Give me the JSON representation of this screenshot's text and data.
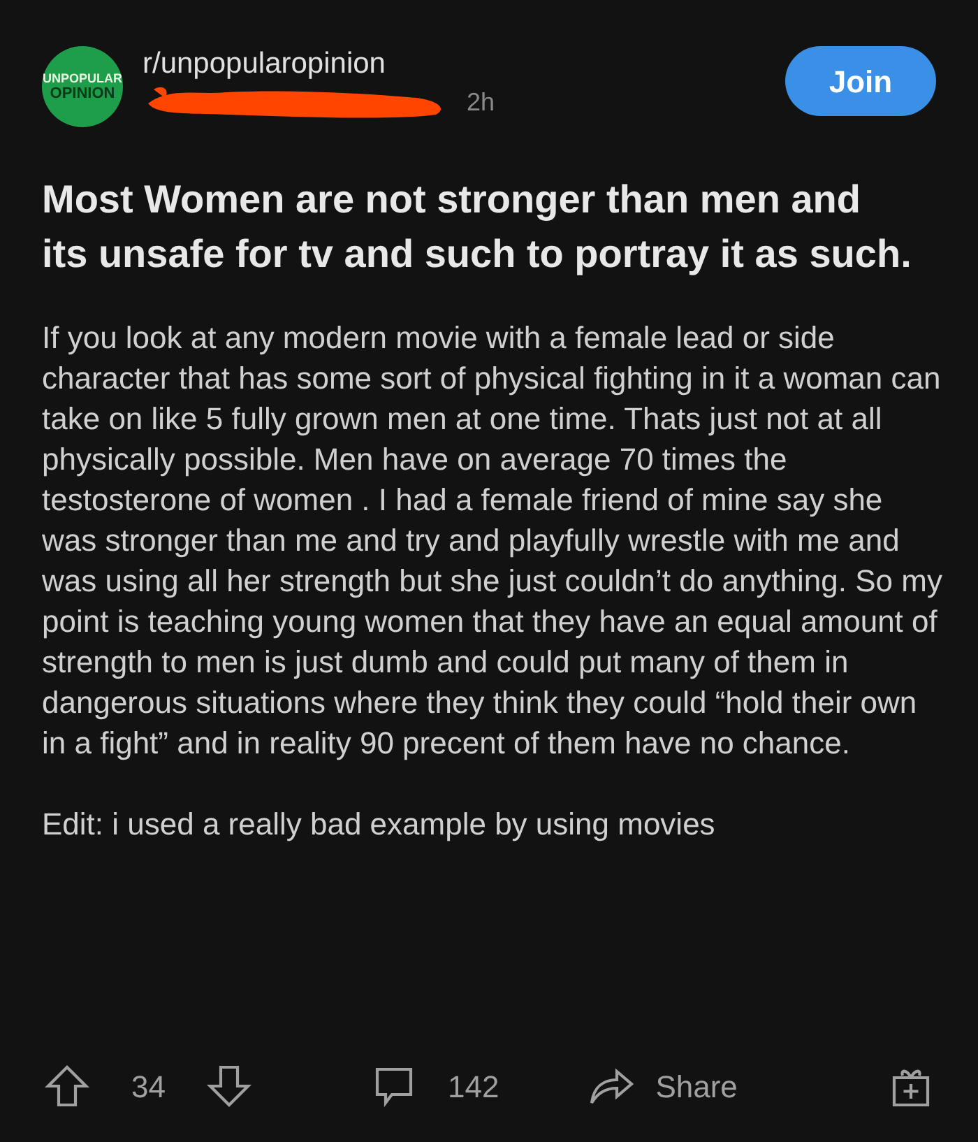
{
  "community": {
    "logo_lines": [
      "UNPOPULAR",
      "OPINION"
    ],
    "name": "r/unpopularopinion",
    "redacted_author": true,
    "age": "2h",
    "join_label": "Join"
  },
  "post": {
    "title": "Most Women are not stronger than men and its unsafe for tv and such to portray it as such.",
    "paragraphs": [
      "If you look at any modern movie with a female lead or side character that has some sort of physical fighting in it a woman can take on like 5 fully grown men at one time. Thats just not at all physically possible. Men have on average 70 times the testosterone of women . I had a female friend of mine say she was stronger than me and try and playfully wrestle with me and was using all her strength but she just couldn’t do anything. So my point is teaching young women that they have an equal amount of strength to men is just dumb and could put many of them in dangerous situations where they think they could “hold their own in a fight” and in reality 90 precent of them have no chance.",
      "Edit: i used a really bad example by using movies"
    ]
  },
  "actions": {
    "score": "34",
    "comments": "142",
    "share_label": "Share"
  }
}
